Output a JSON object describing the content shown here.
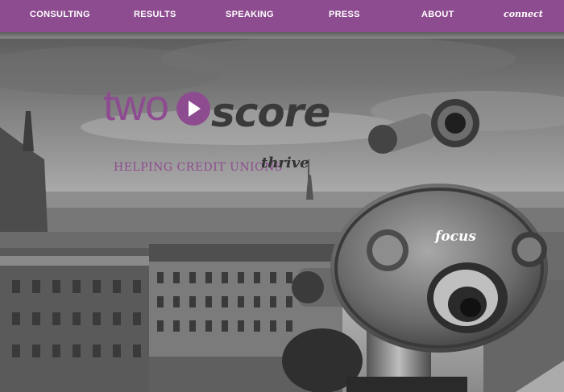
{
  "nav": {
    "items": [
      "CONSULTING",
      "RESULTS",
      "SPEAKING",
      "PRESS",
      "ABOUT"
    ],
    "connect_label": "connect"
  },
  "logo": {
    "part1": "two",
    "part2": "score"
  },
  "tagline": {
    "main": "HELPING CREDIT UNIONS",
    "script": "thrive"
  },
  "hero": {
    "telescope_label": "focus"
  },
  "colors": {
    "brand_purple": "#8e4c90",
    "dark_gray": "#3a3a3a"
  }
}
